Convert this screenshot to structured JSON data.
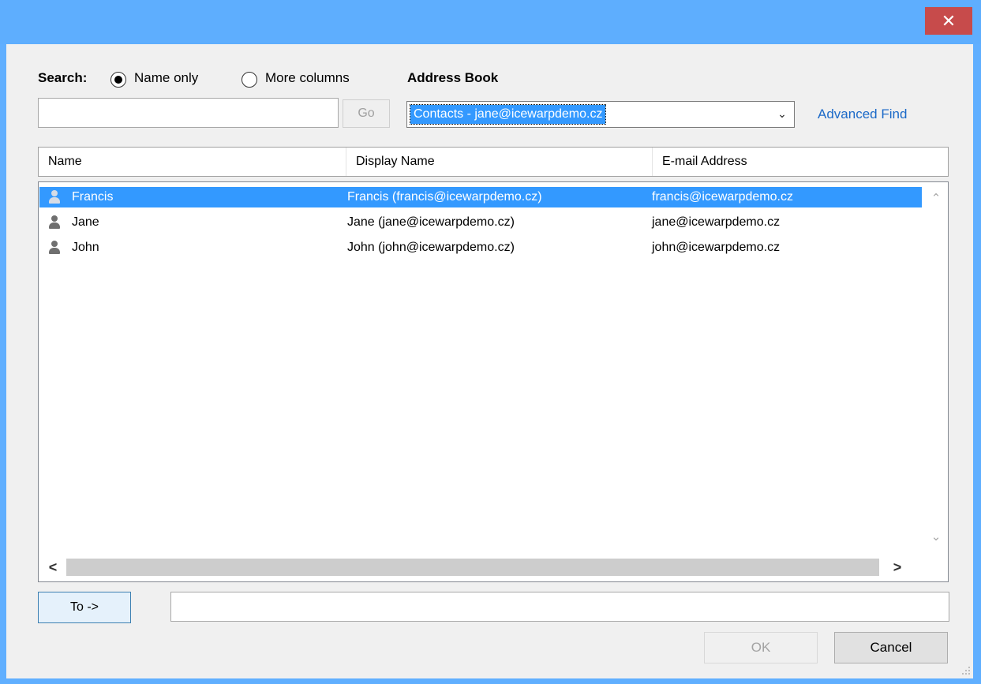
{
  "window": {
    "close_glyph": "✕"
  },
  "search": {
    "label": "Search:",
    "option_name_only": "Name only",
    "option_more_columns": "More columns",
    "selected_option": "Name only",
    "input_value": "",
    "go_label": "Go"
  },
  "address_book": {
    "label": "Address Book",
    "selected": "Contacts - jane@icewarpdemo.cz",
    "dropdown_glyph": "⌄",
    "advanced_find": "Advanced Find"
  },
  "table": {
    "columns": [
      "Name",
      "Display Name",
      "E-mail Address"
    ],
    "rows": [
      {
        "name": "Francis",
        "display_name": "Francis (francis@icewarpdemo.cz)",
        "email": "francis@icewarpdemo.cz",
        "selected": true,
        "icon": "person-icon"
      },
      {
        "name": "Jane",
        "display_name": "Jane (jane@icewarpdemo.cz)",
        "email": "jane@icewarpdemo.cz",
        "selected": false,
        "icon": "person-icon"
      },
      {
        "name": "John",
        "display_name": "John (john@icewarpdemo.cz)",
        "email": "john@icewarpdemo.cz",
        "selected": false,
        "icon": "person-icon"
      }
    ],
    "scroll_up_glyph": "⌃",
    "scroll_down_glyph": "⌄",
    "scroll_left_glyph": "<",
    "scroll_right_glyph": ">"
  },
  "recipients": {
    "to_label": "To ->",
    "to_value": ""
  },
  "footer": {
    "ok_label": "OK",
    "cancel_label": "Cancel"
  },
  "colors": {
    "titlebar": "#5eaefe",
    "close_button": "#c74b4b",
    "selection": "#3399ff",
    "link": "#1c6ac8"
  }
}
